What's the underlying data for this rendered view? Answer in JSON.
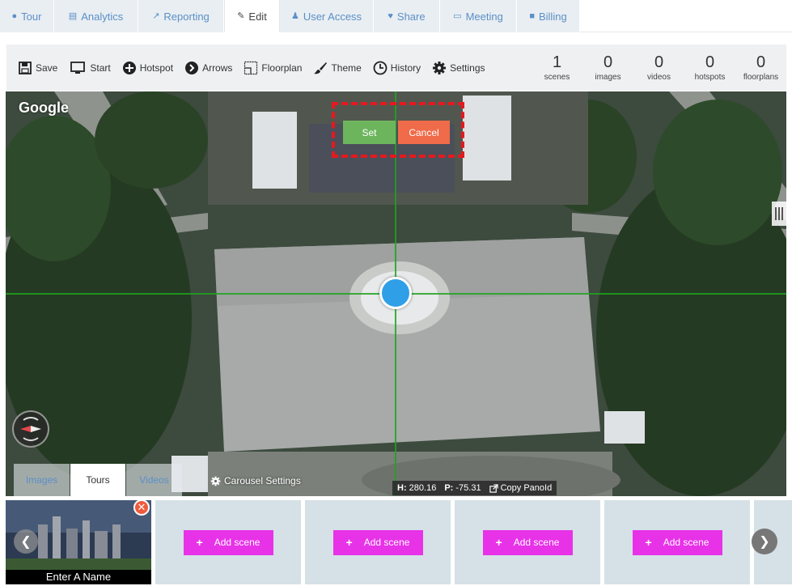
{
  "tabs": [
    {
      "label": "Tour",
      "icon": "map-marker-icon"
    },
    {
      "label": "Analytics",
      "icon": "bar-chart-icon"
    },
    {
      "label": "Reporting",
      "icon": "line-chart-icon"
    },
    {
      "label": "Edit",
      "icon": "pencil-icon",
      "active": true
    },
    {
      "label": "User Access",
      "icon": "users-icon"
    },
    {
      "label": "Share",
      "icon": "heart-icon"
    },
    {
      "label": "Meeting",
      "icon": "monitor-icon"
    },
    {
      "label": "Billing",
      "icon": "lock-icon"
    }
  ],
  "toolbar": {
    "save": "Save",
    "start": "Start",
    "hotspot": "Hotspot",
    "arrows": "Arrows",
    "floorplan": "Floorplan",
    "theme": "Theme",
    "history": "History",
    "settings": "Settings"
  },
  "stats": [
    {
      "value": "1",
      "label": "scenes"
    },
    {
      "value": "0",
      "label": "images"
    },
    {
      "value": "0",
      "label": "videos"
    },
    {
      "value": "0",
      "label": "hotspots"
    },
    {
      "value": "0",
      "label": "floorplans"
    }
  ],
  "viewer": {
    "google": "Google",
    "set": "Set",
    "cancel": "Cancel",
    "carousel_settings": "Carousel Settings",
    "heading_label": "H:",
    "heading": "280.16",
    "pitch_label": "P:",
    "pitch": "-75.31",
    "copy_pano": "Copy PanoId"
  },
  "carousel_tabs": [
    {
      "label": "Images"
    },
    {
      "label": "Tours",
      "active": true
    },
    {
      "label": "Videos"
    }
  ],
  "scene_strip": {
    "thumb_name": "Enter A Name",
    "add_scene": "Add scene",
    "close_glyph": "✕",
    "left_glyph": "❮",
    "right_glyph": "❯"
  },
  "colors": {
    "set": "#6db55d",
    "cancel": "#ef6b4a",
    "add_scene": "#e832e8",
    "crosshair": "#1fa31f",
    "dot": "#2f9fe8"
  }
}
